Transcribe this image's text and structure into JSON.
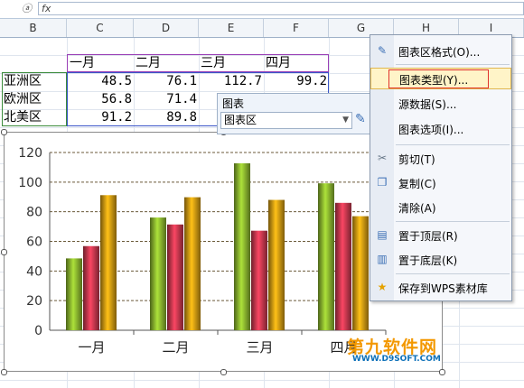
{
  "formula_bar": {
    "fx_label": "fx"
  },
  "columns": [
    "B",
    "C",
    "D",
    "E",
    "F",
    "G",
    "H",
    "I"
  ],
  "table": {
    "headers": [
      "一月",
      "二月",
      "三月",
      "四月"
    ],
    "rows": [
      {
        "region": "亚洲区",
        "values": [
          "48.5",
          "76.1",
          "112.7",
          "99.2"
        ]
      },
      {
        "region": "欧洲区",
        "values": [
          "56.8",
          "71.4",
          "",
          ""
        ]
      },
      {
        "region": "北美区",
        "values": [
          "91.2",
          "89.8",
          "",
          ""
        ]
      }
    ]
  },
  "chart_toolbar": {
    "title": "图表",
    "selected": "图表区"
  },
  "context_menu": {
    "items": [
      {
        "label": "图表区格式(O)...",
        "icon": "format-chart-icon"
      },
      {
        "label": "图表类型(Y)...",
        "icon": "",
        "highlighted": true
      },
      {
        "label": "源数据(S)...",
        "icon": ""
      },
      {
        "label": "图表选项(I)...",
        "icon": ""
      },
      {
        "label": "剪切(T)",
        "icon": "scissors-icon"
      },
      {
        "label": "复制(C)",
        "icon": "copy-icon"
      },
      {
        "label": "清除(A)",
        "icon": ""
      },
      {
        "label": "置于顶层(R)",
        "icon": "bring-to-front-icon"
      },
      {
        "label": "置于底层(K)",
        "icon": "send-to-back-icon"
      },
      {
        "label": "保存到WPS素材库",
        "icon": "star-icon"
      }
    ]
  },
  "chart_data": {
    "type": "bar",
    "categories": [
      "一月",
      "二月",
      "三月",
      "四月"
    ],
    "series": [
      {
        "values": [
          48.5,
          76.1,
          112.7,
          99.2
        ],
        "color": "#8ab52e"
      },
      {
        "values": [
          56.8,
          71.4,
          67.2,
          86.0
        ],
        "color": "#c8384f"
      },
      {
        "values": [
          91.2,
          89.8,
          88.0,
          77.0
        ],
        "color": "#d49a12"
      }
    ],
    "yticks": [
      "0",
      "20",
      "40",
      "60",
      "80",
      "100",
      "120"
    ],
    "ylim": [
      0,
      120
    ],
    "grid": true
  },
  "watermark": {
    "line1": "第九软件网",
    "line2": "WWW.D9SOFT.COM"
  }
}
